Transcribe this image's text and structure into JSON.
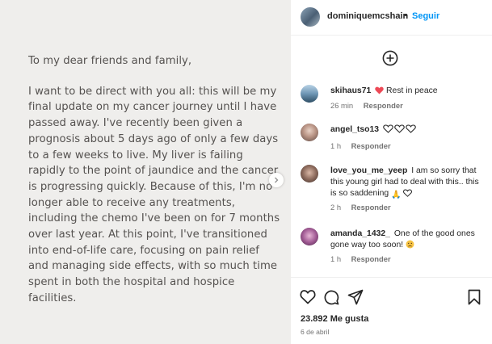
{
  "post": {
    "greeting": "To my dear friends and family,",
    "message": "I want to be direct with you all: this will be my final update on my cancer journey until I have passed away. I've recently been given a prognosis about 5 days ago of only a few days to a few weeks to live. My liver is failing rapidly to the point of jaundice and the cancer is progressing quickly. Because of this, I'm no longer able to receive any treatments, including the chemo I've been on for 7 months over last year. At this point, I've transitioned into end-of-life care, focusing on pain relief and managing side effects, with so much time spent in both the hospital and hospice facilities."
  },
  "header": {
    "username": "dominiquemcshain",
    "separator": "•",
    "follow_label": "Seguir"
  },
  "comments": [
    {
      "username": "skihaus71",
      "text": "Rest in peace",
      "time": "26 min",
      "reply_label": "Responder",
      "emoji": "heart"
    },
    {
      "username": "angel_tso13",
      "text": "",
      "time": "1 h",
      "reply_label": "Responder",
      "emoji": "three-hearts"
    },
    {
      "username": "love_you_me_yeep",
      "text": "I am so sorry that this young girl had to deal with this.. this is so saddening",
      "time": "2 h",
      "reply_label": "Responder",
      "emoji": "pray-heart"
    },
    {
      "username": "amanda_1432_",
      "text": "One of the good ones gone way too soon!",
      "time": "1 h",
      "reply_label": "Responder",
      "emoji": "sad-face"
    }
  ],
  "footer": {
    "likes": "23.892 Me gusta",
    "date": "6 de abril"
  },
  "colors": {
    "follow": "#0095f6",
    "heart": "#ed4956",
    "post_background": "#efeeec",
    "post_text": "#555250"
  }
}
